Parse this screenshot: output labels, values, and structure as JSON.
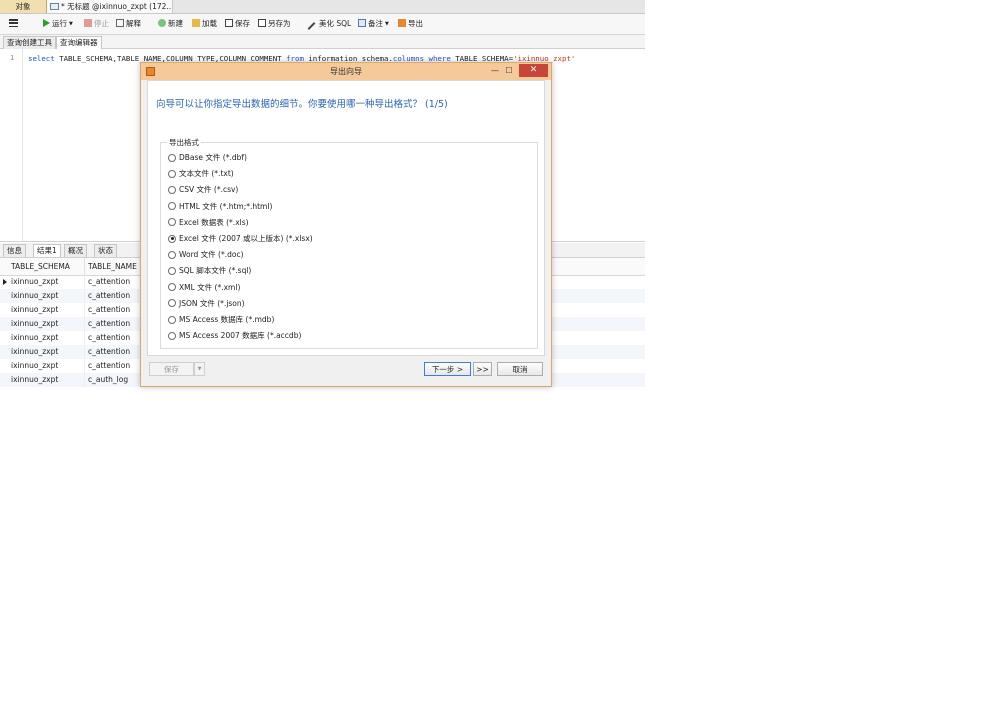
{
  "tabs": {
    "objects_label": "对象",
    "query_label": "* 无标题 @ixinnuo_zxpt (172..."
  },
  "toolbar": {
    "run": "运行",
    "stop": "停止",
    "explain": "解释",
    "new": "新建",
    "load": "加载",
    "save": "保存",
    "save_as": "另存为",
    "beautify": "美化 SQL",
    "note": "备注",
    "export": "导出"
  },
  "subtabs": {
    "builder": "查询创建工具",
    "editor": "查询编辑器"
  },
  "editor": {
    "line_number": "1",
    "code_kw1": "select",
    "code_cols": " TABLE_SCHEMA,TABLE_NAME,COLUMN_TYPE,COLUMN_COMMENT ",
    "code_kw2": "from",
    "code_tbl": " information_schema.",
    "code_kw3": "columns",
    "code_sp": " ",
    "code_kw4": "where",
    "code_cond": " TABLE_SCHEMA=",
    "code_str": "'ixinnuo_zxpt'"
  },
  "result_tabs": [
    "信息",
    "结果1",
    "概况",
    "状态"
  ],
  "grid": {
    "columns": [
      "TABLE_SCHEMA",
      "TABLE_NAME"
    ],
    "rows": [
      [
        "ixinnuo_zxpt",
        "c_attention"
      ],
      [
        "ixinnuo_zxpt",
        "c_attention"
      ],
      [
        "ixinnuo_zxpt",
        "c_attention"
      ],
      [
        "ixinnuo_zxpt",
        "c_attention"
      ],
      [
        "ixinnuo_zxpt",
        "c_attention"
      ],
      [
        "ixinnuo_zxpt",
        "c_attention"
      ],
      [
        "ixinnuo_zxpt",
        "c_attention"
      ],
      [
        "ixinnuo_zxpt",
        "c_auth_log"
      ]
    ]
  },
  "dialog": {
    "title": "导出向导",
    "minimize": "—",
    "maximize": "☐",
    "close": "✕",
    "prompt": "向导可以让你指定导出数据的细节。你要使用哪一种导出格式？ (1/5)",
    "group_label": "导出格式",
    "options": [
      "DBase 文件 (*.dbf)",
      "文本文件 (*.txt)",
      "CSV 文件 (*.csv)",
      "HTML 文件 (*.htm;*.html)",
      "Excel 数据表 (*.xls)",
      "Excel 文件 (2007 或以上版本) (*.xlsx)",
      "Word 文件 (*.doc)",
      "SQL 脚本文件 (*.sql)",
      "XML 文件 (*.xml)",
      "JSON 文件 (*.json)",
      "MS Access 数据库 (*.mdb)",
      "MS Access 2007 数据库 (*.accdb)"
    ],
    "selected_index": 5,
    "save_button": "保存",
    "next_button": "下一步 >",
    "last_button": ">>",
    "cancel_button": "取消"
  },
  "colors": {
    "title_bar": "#f6c99a",
    "prompt_text": "#2b63b6",
    "close_button": "#c7453a"
  }
}
